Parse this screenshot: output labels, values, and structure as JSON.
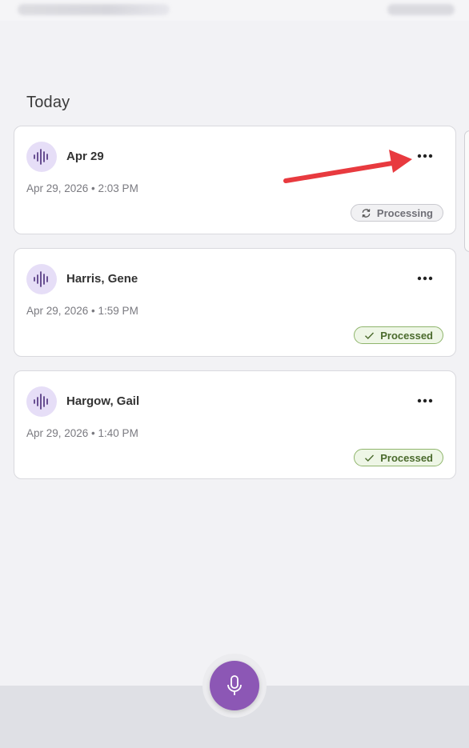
{
  "list": {
    "section_title": "Today",
    "recordings": [
      {
        "title": "Apr 29",
        "datetime": "Apr 29, 2026 • 2:03 PM",
        "status": "Processing",
        "status_type": "processing",
        "icon": "audio-wave-icon"
      },
      {
        "title": "Harris, Gene",
        "datetime": "Apr 29, 2026 • 1:59 PM",
        "status": "Processed",
        "status_type": "processed",
        "icon": "audio-wave-icon"
      },
      {
        "title": "Hargow, Gail",
        "datetime": "Apr 29, 2026 • 1:40 PM",
        "status": "Processed",
        "status_type": "processed",
        "icon": "audio-wave-icon"
      }
    ]
  },
  "icons": {
    "more": "more-horizontal-icon",
    "processing": "sync-icon",
    "processed": "check-icon",
    "record": "microphone-icon"
  },
  "colors": {
    "accent": "#8c57b5",
    "avatar_bg": "#e6def7",
    "processed_border": "#8fb56c",
    "processed_text": "#4a6a2c",
    "annotation_arrow": "#e83a3f"
  }
}
